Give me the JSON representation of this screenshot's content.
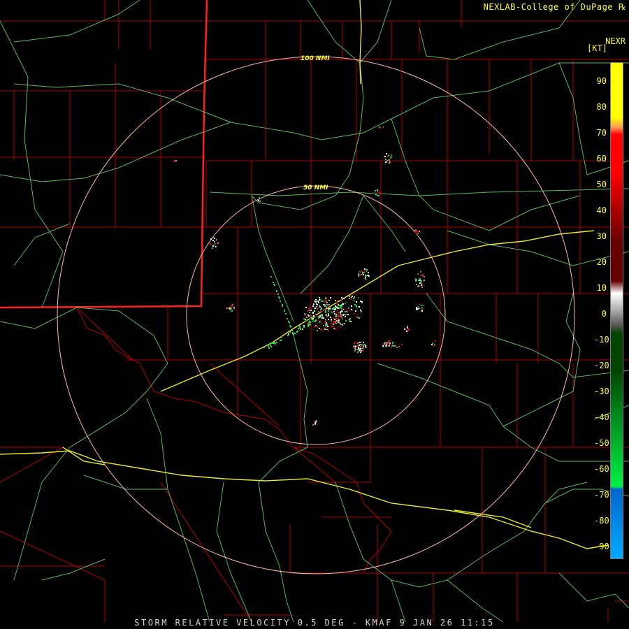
{
  "header": {
    "credit": "NEXLAB-College of DuPage ℞"
  },
  "footer": {
    "product_title": "STORM RELATIVE VELOCITY 0.5 DEG - KMAF 9 JAN 26 11:15"
  },
  "map": {
    "range_rings": [
      {
        "label": "100 NMI",
        "range_nmi": 100
      },
      {
        "label": "50 NMI",
        "range_nmi": 50
      }
    ]
  },
  "legend": {
    "title": "NEXR",
    "unit": "[KT]",
    "ticks": [
      "90",
      "80",
      "70",
      "60",
      "50",
      "40",
      "30",
      "20",
      "10",
      "0",
      "-10",
      "-20",
      "-30",
      "-40",
      "-50",
      "-60",
      "-70",
      "-80",
      "-90"
    ],
    "tick_values": [
      90,
      80,
      70,
      60,
      50,
      40,
      30,
      20,
      10,
      0,
      -10,
      -20,
      -30,
      -40,
      -50,
      -60,
      -70,
      -80,
      -90
    ],
    "colors": {
      "outbound_max": "#ffff00",
      "outbound_orange": "#ff9955",
      "outbound_red": "#ff0000",
      "outbound_dark": "#660000",
      "near_zero": "#aaaaaa",
      "inbound_dark": "#004400",
      "inbound_green": "#00ee44",
      "inbound_blue": "#0066cc",
      "inbound_max": "#00aaff"
    }
  }
}
